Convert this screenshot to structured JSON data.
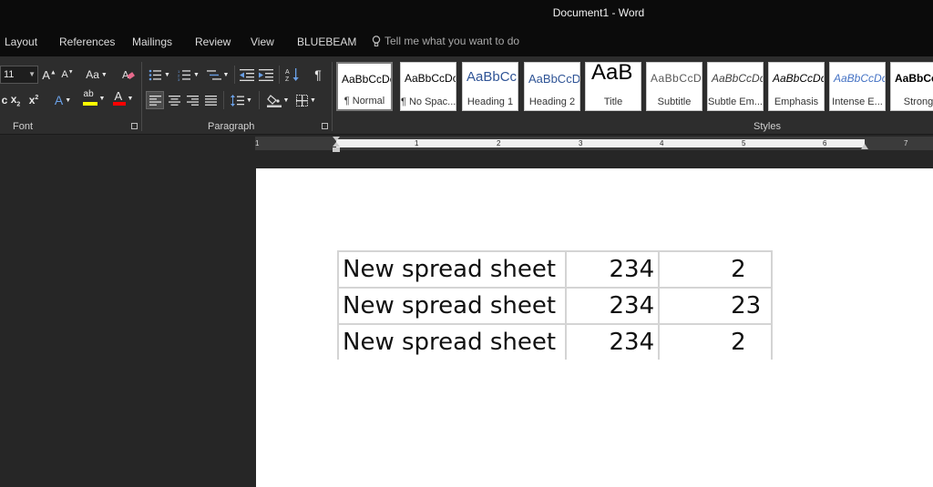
{
  "window": {
    "title": "Document1  -  Word"
  },
  "tabs": [
    "Layout",
    "References",
    "Mailings",
    "Review",
    "View",
    "BLUEBEAM"
  ],
  "tell_me": {
    "placeholder": "Tell me what you want to do"
  },
  "ribbon": {
    "font_size": "11",
    "change_case_label": "Aa",
    "groups": {
      "font": "Font",
      "paragraph": "Paragraph",
      "styles": "Styles"
    },
    "styles": [
      {
        "preview": "AaBbCcDc",
        "name": "¶ Normal",
        "selected": true
      },
      {
        "preview": "AaBbCcDc",
        "name": "¶ No Spac..."
      },
      {
        "preview": "AaBbCc",
        "name": "Heading 1"
      },
      {
        "preview": "AaBbCcD",
        "name": "Heading 2"
      },
      {
        "preview": "AaB",
        "name": "Title"
      },
      {
        "preview": "AaBbCcD",
        "name": "Subtitle"
      },
      {
        "preview": "AaBbCcDc",
        "name": "Subtle Em..."
      },
      {
        "preview": "AaBbCcDc",
        "name": "Emphasis"
      },
      {
        "preview": "AaBbCcDc",
        "name": "Intense E..."
      },
      {
        "preview": "AaBbCcDc",
        "name": "Strong"
      }
    ],
    "colors": {
      "highlight": "#ffff00",
      "font_color": "#ff0000"
    }
  },
  "ruler": {
    "numbers": [
      "1",
      "1",
      "2",
      "3",
      "4",
      "5",
      "6",
      "7"
    ]
  },
  "document": {
    "table": [
      [
        "New spread sheet",
        "234",
        "2"
      ],
      [
        "New spread sheet",
        "234",
        "23"
      ],
      [
        "New spread sheet",
        "234",
        "2"
      ]
    ]
  }
}
